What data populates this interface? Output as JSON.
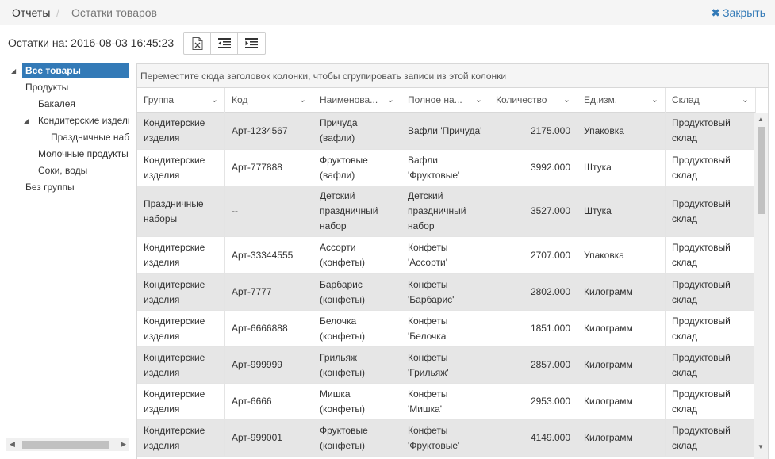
{
  "breadcrumb": {
    "root": "Отчеты",
    "separator": "/",
    "current": "Остатки товаров"
  },
  "close_label": "Закрыть",
  "stock_date": "Остатки на: 2016-08-03 16:45:23",
  "tree": [
    {
      "label": "Все товары"
    },
    {
      "label": "Продукты"
    },
    {
      "label": "Бакалея"
    },
    {
      "label": "Кондитерские изделия"
    },
    {
      "label": "Праздничные наборы"
    },
    {
      "label": "Молочные продукты"
    },
    {
      "label": "Соки, воды"
    },
    {
      "label": "Без группы"
    }
  ],
  "group_panel_text": "Переместите сюда заголовок колонки, чтобы сгрупировать записи из этой колонки",
  "columns": [
    "Группа",
    "Код",
    "Наименова...",
    "Полное на...",
    "Количество",
    "Ед.изм.",
    "Склад"
  ],
  "rows": [
    {
      "group": "Кондитерские изделия",
      "code": "Арт-1234567",
      "name": "Причуда (вафли)",
      "full_name": "Вафли 'Причуда'",
      "qty": "2175.000",
      "unit": "Упаковка",
      "warehouse": "Продуктовый склад"
    },
    {
      "group": "Кондитерские изделия",
      "code": "Арт-777888",
      "name": "Фруктовые (вафли)",
      "full_name": "Вафли 'Фруктовые'",
      "qty": "3992.000",
      "unit": "Штука",
      "warehouse": "Продуктовый склад"
    },
    {
      "group": "Праздничные наборы",
      "code": "--",
      "name": "Детский праздничный набор",
      "full_name": "Детский праздничный набор",
      "qty": "3527.000",
      "unit": "Штука",
      "warehouse": "Продуктовый склад"
    },
    {
      "group": "Кондитерские изделия",
      "code": "Арт-33344555",
      "name": "Ассорти (конфеты)",
      "full_name": "Конфеты 'Ассорти'",
      "qty": "2707.000",
      "unit": "Упаковка",
      "warehouse": "Продуктовый склад"
    },
    {
      "group": "Кондитерские изделия",
      "code": "Арт-7777",
      "name": "Барбарис (конфеты)",
      "full_name": "Конфеты 'Барбарис'",
      "qty": "2802.000",
      "unit": "Килограмм",
      "warehouse": "Продуктовый склад"
    },
    {
      "group": "Кондитерские изделия",
      "code": "Арт-6666888",
      "name": "Белочка (конфеты)",
      "full_name": "Конфеты 'Белочка'",
      "qty": "1851.000",
      "unit": "Килограмм",
      "warehouse": "Продуктовый склад"
    },
    {
      "group": "Кондитерские изделия",
      "code": "Арт-999999",
      "name": "Грильяж (конфеты)",
      "full_name": "Конфеты 'Грильяж'",
      "qty": "2857.000",
      "unit": "Килограмм",
      "warehouse": "Продуктовый склад"
    },
    {
      "group": "Кондитерские изделия",
      "code": "Арт-6666",
      "name": "Мишка (конфеты)",
      "full_name": "Конфеты 'Мишка'",
      "qty": "2953.000",
      "unit": "Килограмм",
      "warehouse": "Продуктовый склад"
    },
    {
      "group": "Кондитерские изделия",
      "code": "Арт-999001",
      "name": "Фруктовые (конфеты)",
      "full_name": "Конфеты 'Фруктовые'",
      "qty": "4149.000",
      "unit": "Килограмм",
      "warehouse": "Продуктовый склад"
    }
  ]
}
